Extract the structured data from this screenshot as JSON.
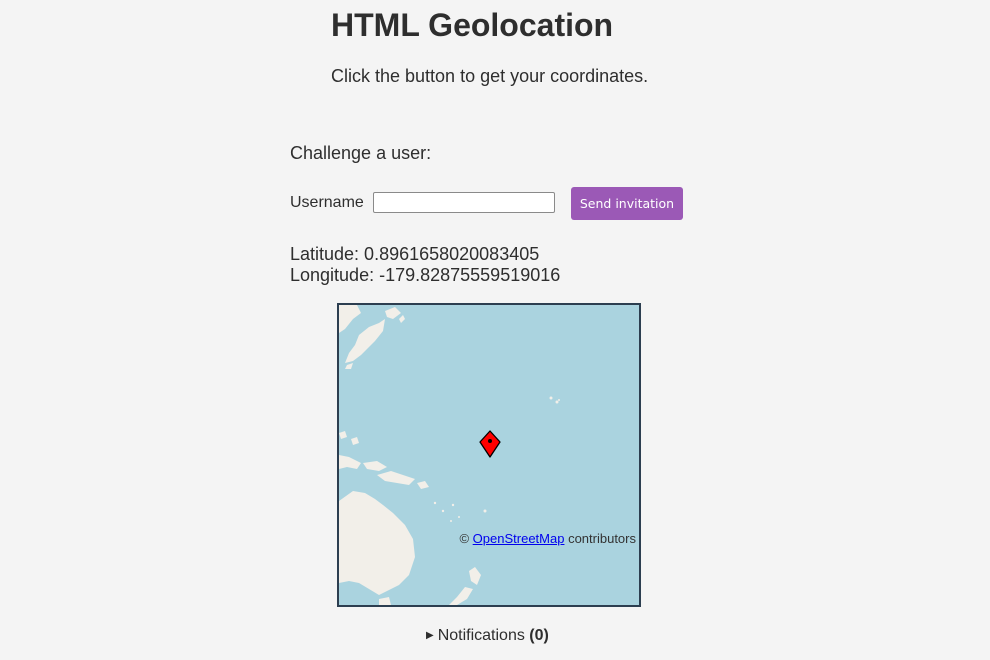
{
  "page": {
    "title": "HTML Geolocation",
    "subtitle": "Click the button to get your coordinates."
  },
  "challenge": {
    "heading": "Challenge a user:",
    "username_label": "Username",
    "username_value": "",
    "send_button": "Send invitation"
  },
  "location": {
    "latitude_text": "Latitude: 0.8961658020083405",
    "longitude_text": "Longitude: -179.82875559519016"
  },
  "map": {
    "attribution_prefix": "© ",
    "attribution_link": "OpenStreetMap",
    "attribution_suffix": " contributors",
    "marker_icon": "map-pin-icon",
    "colors": {
      "water": "#aad3df",
      "land": "#f2efe9",
      "marker": "#ff0000",
      "border": "#2c3e50"
    }
  },
  "notifications": {
    "label": "Notifications ",
    "count": "(0)"
  },
  "colors": {
    "accent": "#9b59b6",
    "background": "#f4f4f4"
  }
}
